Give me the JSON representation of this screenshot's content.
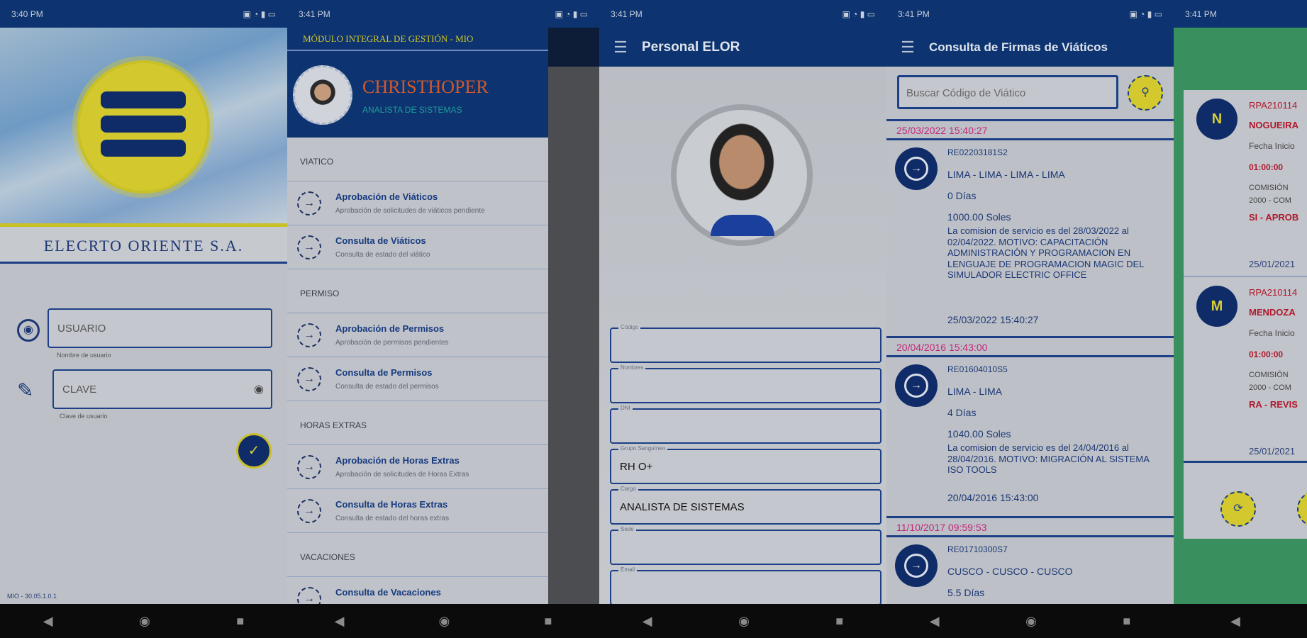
{
  "colors": {
    "primary": "#0d3470",
    "accent_yellow": "#d8cf33",
    "date_pink": "#c2257a",
    "status_red": "#b0182c",
    "green_bg": "#3a8f5e"
  },
  "status_bars": [
    {
      "time": "3:40 PM",
      "icons": "▣ ◔ ▮ ▭"
    },
    {
      "time": "3:41 PM",
      "icons": "▣ ◔ ▮ ▭"
    },
    {
      "time": "3:41 PM",
      "icons": "▣ ◔ ▮ ▭"
    },
    {
      "time": "3:41 PM",
      "icons": "▣ ◔ ▮ ▭"
    },
    {
      "time": "3:41 PM",
      "icons": ""
    }
  ],
  "nav": {
    "back": "◀",
    "home": "◉",
    "recent": "■"
  },
  "login": {
    "company": "ELECRTO ORIENTE S.A.",
    "user_placeholder": "USUARIO",
    "user_hint": "Nombre de usuario",
    "pass_placeholder": "CLAVE",
    "pass_hint": "Clave de usuario",
    "version": "MIO - 30.05.1.0.1",
    "submit_icon": "✓"
  },
  "drawer": {
    "title": "MÓDULO INTEGRAL DE GESTIÓN - MIO",
    "user_name": "CHRISTHOPER",
    "user_role": "ANALISTA DE SISTEMAS",
    "sections": [
      {
        "label": "VIATICO",
        "items": [
          {
            "title": "Aprobación de Viáticos",
            "sub": "Aprobación de solicitudes de viáticos pendiente"
          },
          {
            "title": "Consulta de Viáticos",
            "sub": "Consulta de estado del viático"
          }
        ]
      },
      {
        "label": "PERMISO",
        "items": [
          {
            "title": "Aprobación de Permisos",
            "sub": "Aprobación de permisos pendientes"
          },
          {
            "title": "Consulta de Permisos",
            "sub": "Consulta de estado del permisos"
          }
        ]
      },
      {
        "label": "HORAS EXTRAS",
        "items": [
          {
            "title": "Aprobación de Horas Extras",
            "sub": "Aprobación de solicitudes de Horas Extras"
          },
          {
            "title": "Consulta de Horas Extras",
            "sub": "Consulta de estado del horas extras"
          }
        ]
      },
      {
        "label": "VACACIONES",
        "items": [
          {
            "title": "Consulta de Vacaciones",
            "sub": ""
          }
        ]
      }
    ]
  },
  "personal": {
    "title": "Personal ELOR",
    "fields": [
      {
        "label": "Código",
        "value": ""
      },
      {
        "label": "Nombres",
        "value": ""
      },
      {
        "label": "DNI",
        "value": ""
      },
      {
        "label": "Grupo Sanguíneo",
        "value": "RH O+"
      },
      {
        "label": "Cargo",
        "value": "ANALISTA DE SISTEMAS"
      },
      {
        "label": "Sede",
        "value": ""
      },
      {
        "label": "Email",
        "value": ""
      }
    ]
  },
  "viaticos": {
    "title": "Consulta de Firmas de Viáticos",
    "search_placeholder": "Buscar Código de Viático",
    "groups": [
      {
        "date": "25/03/2022 15:40:27",
        "code": "RE02203181S2",
        "route": "LIMA - LIMA - LIMA - LIMA",
        "days": "0 Días",
        "amount": "1000.00 Soles",
        "desc": "La comision de servicio es del 28/03/2022 al 02/04/2022. MOTIVO: CAPACITACIÓN ADMINISTRACIÓN Y PROGRAMACION EN LENGUAJE DE PROGRAMACION MAGIC DEL SIMULADOR ELECTRIC OFFICE",
        "stamp": "25/03/2022 15:40:27"
      },
      {
        "date": "20/04/2016 15:43:00",
        "code": "RE01604010S5",
        "route": "LIMA - LIMA",
        "days": "4 Días",
        "amount": "1040.00 Soles",
        "desc": "La comision de servicio es del 24/04/2016 al 28/04/2016. MOTIVO: MIGRACIÓN AL SISTEMA ISO TOOLS",
        "stamp": "20/04/2016 15:43:00"
      },
      {
        "date": "11/10/2017 09:59:53",
        "code": "RE01710300S7",
        "route": "CUSCO - CUSCO - CUSCO",
        "days": "5.5 Días",
        "amount": "",
        "desc": "",
        "stamp": ""
      }
    ]
  },
  "firmas": {
    "cards": [
      {
        "initial": "N",
        "code": "RPA210114",
        "name": "NOGUEIRA",
        "label": "Fecha Inicio",
        "time": "01:00:00",
        "desc1": "COMISIÓN",
        "desc2": "2000 - COM",
        "status": "SI - APROB",
        "date": "25/01/2021"
      },
      {
        "initial": "M",
        "code": "RPA210114",
        "name": "MENDOZA",
        "label": "Fecha Inicio",
        "time": "01:00:00",
        "desc1": "COMISIÓN",
        "desc2": "2000 - COM",
        "status": "RA - REVIS",
        "date": "25/01/2021"
      }
    ]
  }
}
